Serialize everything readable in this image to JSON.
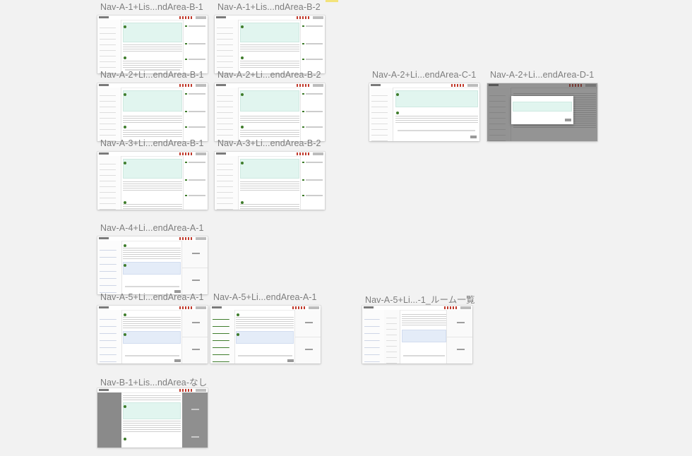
{
  "canvas": {
    "background": "#f2f2f2",
    "accent_green": "#3f7d2c",
    "message_bg": "#e1f5ef",
    "selected_bg": "#e4ecf8"
  },
  "artboards": [
    {
      "id": "a1b1",
      "title": "Nav-A-1+Lis...ndArea-B-1"
    },
    {
      "id": "a1b2",
      "title": "Nav-A-1+Lis...ndArea-B-2"
    },
    {
      "id": "a2b1",
      "title": "Nav-A-2+Li...endArea-B-1"
    },
    {
      "id": "a2b2",
      "title": "Nav-A-2+Li...endArea-B-2"
    },
    {
      "id": "a2c1",
      "title": "Nav-A-2+Li...endArea-C-1"
    },
    {
      "id": "a2d1",
      "title": "Nav-A-2+Li...endArea-D-1"
    },
    {
      "id": "a3b1",
      "title": "Nav-A-3+Li...endArea-B-1"
    },
    {
      "id": "a3b2",
      "title": "Nav-A-3+Li...endArea-B-2"
    },
    {
      "id": "a4a1",
      "title": "Nav-A-4+Li...endArea-A-1"
    },
    {
      "id": "a5a1x",
      "title": "Nav-A-5+Li...endArea-A-1"
    },
    {
      "id": "a5a1y",
      "title": "Nav-A-5+Li...endArea-A-1"
    },
    {
      "id": "a5room",
      "title": "Nav-A-5+Li...-1_ルーム一覧"
    },
    {
      "id": "b1none",
      "title": "Nav-B-1+Lis...ndArea-なし"
    }
  ]
}
